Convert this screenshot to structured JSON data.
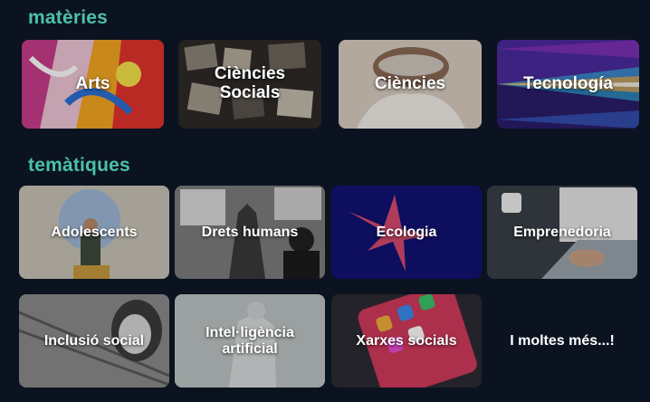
{
  "sections": {
    "materies": {
      "title": "matèries",
      "cards": {
        "arts": "Arts",
        "socials": "Ciències Socials",
        "ciencies": "Ciències",
        "tecnologia": "Tecnología"
      }
    },
    "tematiques": {
      "title": "temàtiques",
      "cards": {
        "adolescents": "Adolescents",
        "drets": "Drets humans",
        "ecologia": "Ecologia",
        "emprenedoria": "Emprenedoria",
        "inclusio": "Inclusió social",
        "ia": "Intel·ligència artificial",
        "xarxes": "Xarxes socials"
      },
      "more": "I moltes més...!"
    }
  },
  "colors": {
    "background": "#0b1320",
    "accent": "#4cc1a8"
  }
}
